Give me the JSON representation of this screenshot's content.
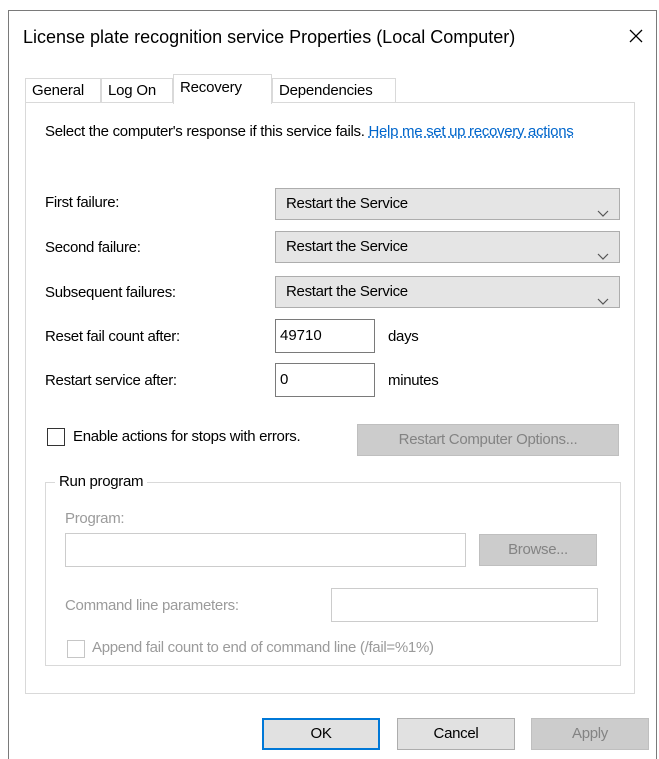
{
  "window": {
    "title": "License plate recognition service Properties (Local Computer)",
    "close_icon": "close-icon"
  },
  "tabs": [
    {
      "label": "General",
      "active": false
    },
    {
      "label": "Log On",
      "active": false
    },
    {
      "label": "Recovery",
      "active": true
    },
    {
      "label": "Dependencies",
      "active": false
    }
  ],
  "recovery": {
    "intro_text": "Select the computer's response if this service fails.",
    "help_link": "Help me set up recovery actions",
    "first_failure": {
      "label": "First failure:",
      "value": "Restart the Service"
    },
    "second_failure": {
      "label": "Second failure:",
      "value": "Restart the Service"
    },
    "subsequent_failures": {
      "label": "Subsequent failures:",
      "value": "Restart the Service"
    },
    "reset_fail_count": {
      "label": "Reset fail count after:",
      "value": "49710",
      "unit": "days"
    },
    "restart_service": {
      "label": "Restart service after:",
      "value": "0",
      "unit": "minutes"
    },
    "enable_actions": {
      "label": "Enable actions for stops with errors.",
      "checked": false
    },
    "restart_computer_button": "Restart Computer Options..."
  },
  "run_program": {
    "title": "Run program",
    "program_label": "Program:",
    "program_value": "",
    "browse_button": "Browse...",
    "cmd_label": "Command line parameters:",
    "cmd_value": "",
    "append_label": "Append fail count to end of command line (/fail=%1%)",
    "append_checked": false
  },
  "footer": {
    "ok": "OK",
    "cancel": "Cancel",
    "apply": "Apply"
  },
  "colors": {
    "link": "#0066cc",
    "default_button_border": "#0078d7",
    "disabled_text": "#9b9b9b"
  }
}
